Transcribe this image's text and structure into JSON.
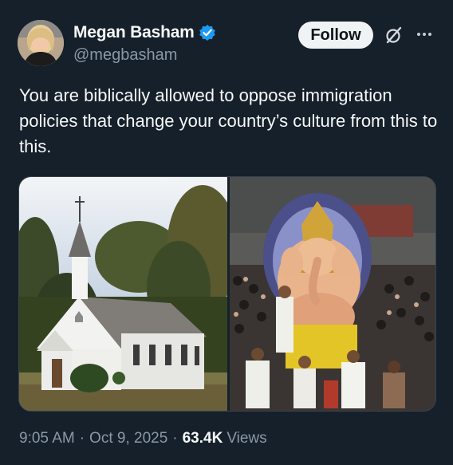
{
  "author": {
    "display_name": "Megan Basham",
    "handle": "@megbasham",
    "verified": true,
    "avatar_icon": "profile-photo"
  },
  "actions": {
    "follow_label": "Follow",
    "grok_icon": "grok-icon",
    "more_icon": "more-icon"
  },
  "tweet": {
    "text": "You are biblically allowed to oppose immigration policies that change your country’s culture from this to this."
  },
  "media": {
    "left_image": "white-church-photo",
    "right_image": "ganesh-festival-photo"
  },
  "meta": {
    "time": "9:05 AM",
    "separator": "·",
    "date": "Oct 9, 2025",
    "views_count": "63.4K",
    "views_label": "Views"
  },
  "colors": {
    "background": "#15202b",
    "text": "#f7f9f9",
    "secondary_text": "#8b98a5",
    "verified_blue": "#1d9bf0",
    "follow_bg": "#eff3f4"
  }
}
